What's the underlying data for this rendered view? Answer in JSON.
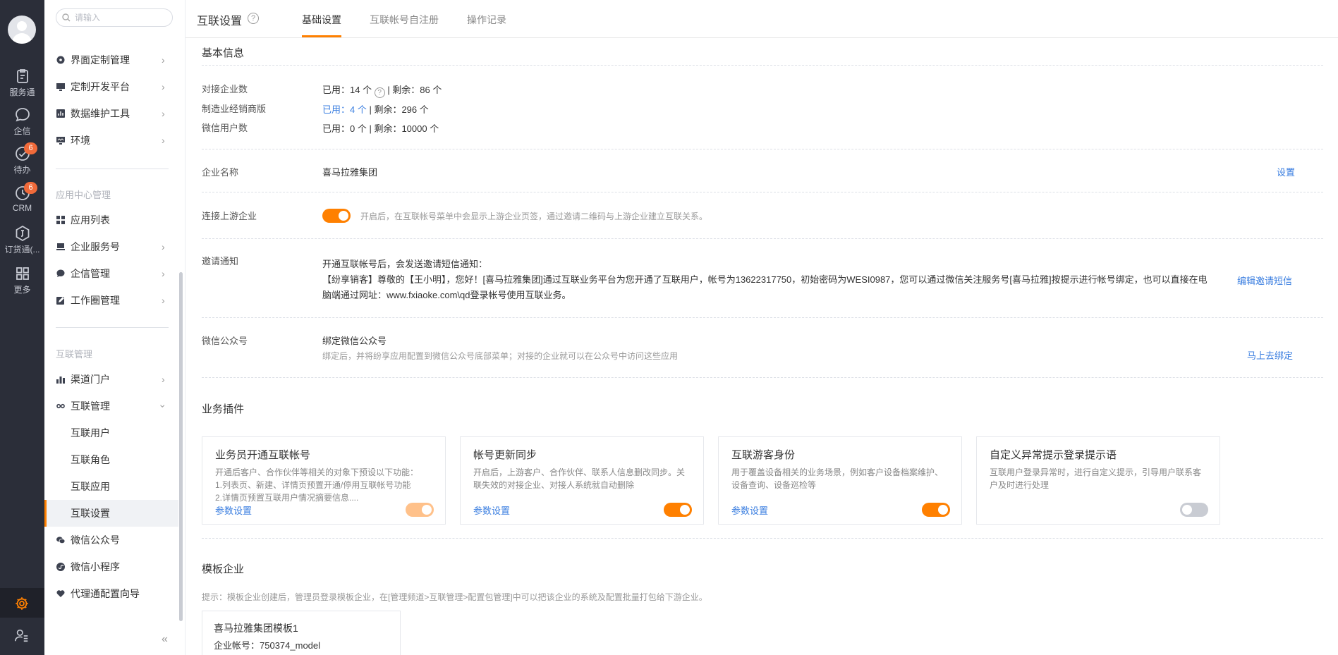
{
  "rail": {
    "items": [
      {
        "label": "服务通",
        "icon": "service-clipboard-icon"
      },
      {
        "label": "企信",
        "icon": "chat-bubble-icon"
      },
      {
        "label": "待办",
        "icon": "check-circle-icon",
        "badge": "6"
      },
      {
        "label": "CRM",
        "icon": "clock-icon",
        "badge": "6"
      },
      {
        "label": "订货通(...",
        "icon": "order-icon"
      },
      {
        "label": "更多",
        "icon": "grid-icon"
      }
    ]
  },
  "nav": {
    "search_placeholder": "请输入",
    "items_top": [
      {
        "label": "界面定制管理"
      },
      {
        "label": "定制开发平台"
      },
      {
        "label": "数据维护工具"
      },
      {
        "label": "环境"
      }
    ],
    "group_app": "应用中心管理",
    "items_app": [
      {
        "label": "应用列表"
      },
      {
        "label": "企业服务号"
      },
      {
        "label": "企信管理"
      },
      {
        "label": "工作圈管理"
      }
    ],
    "group_link": "互联管理",
    "items_link": [
      {
        "label": "渠道门户"
      },
      {
        "label": "互联管理"
      }
    ],
    "sub_items": [
      {
        "label": "互联用户"
      },
      {
        "label": "互联角色"
      },
      {
        "label": "互联应用"
      },
      {
        "label": "互联设置"
      }
    ],
    "items_bottom": [
      {
        "label": "微信公众号"
      },
      {
        "label": "微信小程序"
      },
      {
        "label": "代理通配置向导"
      }
    ],
    "collapse_glyph": "«"
  },
  "topbar": {
    "title": "互联设置",
    "help": "?",
    "tabs": [
      {
        "label": "基础设置",
        "active": true
      },
      {
        "label": "互联帐号自注册",
        "active": false
      },
      {
        "label": "操作记录",
        "active": false
      }
    ]
  },
  "basic": {
    "title": "基本信息",
    "rows": [
      {
        "label": "对接企业数",
        "used": "已用：14 个",
        "rest": " | 剩余：86 个"
      },
      {
        "label": "制造业经销商版",
        "used": "已用：4 个",
        "rest": " | 剩余：296 个"
      },
      {
        "label": "微信用户数",
        "used": "已用：0 个",
        "rest": " | 剩余：10000 个"
      }
    ],
    "company_label": "企业名称",
    "company_value": "喜马拉雅集团",
    "company_action": "设置",
    "upstream_label": "连接上游企业",
    "upstream_on": true,
    "upstream_hint": "开启后，在互联帐号菜单中会显示上游企业页签，通过邀请二维码与上游企业建立互联关系。",
    "invite_label": "邀请通知",
    "invite_head": "开通互联帐号后，会发送邀请短信通知：",
    "invite_body": "【纷享销客】尊敬的【王小明】，您好！[喜马拉雅集团]通过互联业务平台为您开通了互联用户，帐号为13622317750，初始密码为WESI0987，您可以通过微信关注服务号[喜马拉雅]按提示进行帐号绑定，也可以直接在电脑端通过网址：www.fxiaoke.com\\qd登录帐号使用互联业务。",
    "invite_action": "编辑邀请短信",
    "wechat_label": "微信公众号",
    "wechat_title": "绑定微信公众号",
    "wechat_hint": "绑定后，并将纷享应用配置到微信公众号底部菜单；对接的企业就可以在公众号中访问这些应用",
    "wechat_action": "马上去绑定"
  },
  "plugins": {
    "title": "业务插件",
    "cards": [
      {
        "title": "业务员开通互联帐号",
        "desc": [
          "开通后客户、合作伙伴等相关的对象下预设以下功能：",
          "1.列表页、新建、详情页预置开通/停用互联帐号功能",
          "2.详情页预置互联用户情况摘要信息...."
        ],
        "link": "参数设置",
        "state": "on-light"
      },
      {
        "title": "帐号更新同步",
        "desc": [
          "开启后，上游客户、合作伙伴、联系人信息删改同步。关",
          "联失效的对接企业、对接人系统就自动删除"
        ],
        "link": "参数设置",
        "state": "on"
      },
      {
        "title": "互联游客身份",
        "desc": [
          "用于覆盖设备相关的业务场景，例如客户设备档案维护、",
          "设备查询、设备巡检等"
        ],
        "link": "参数设置",
        "state": "on"
      },
      {
        "title": "自定义异常提示登录提示语",
        "desc": [
          "互联用户登录异常时，进行自定义提示，引导用户联系客",
          "户及时进行处理"
        ],
        "link": "",
        "state": "off"
      }
    ]
  },
  "template": {
    "title": "模板企业",
    "hint": "提示：模板企业创建后，管理员登录模板企业，在[管理频道>互联管理>配置包管理]中可以把该企业的系统及配置批量打包给下游企业。",
    "card_title": "喜马拉雅集团模板1",
    "card_account": "企业帐号：750374_model"
  },
  "colors": {
    "accent": "#ff8000",
    "link": "#3a7ee0",
    "rail": "#2b2e39"
  }
}
